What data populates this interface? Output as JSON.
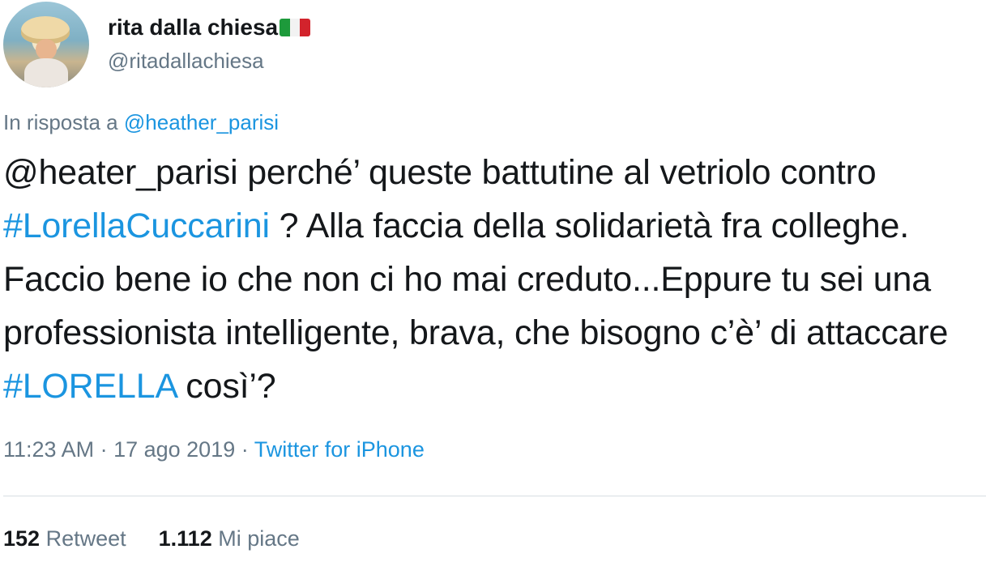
{
  "author": {
    "display_name": "rita dalla chiesa",
    "flag_icon": "italian-flag-icon",
    "handle": "@ritadallachiesa"
  },
  "reply": {
    "prefix": "In risposta a",
    "mention": "@heather_parisi"
  },
  "tweet": {
    "segments": [
      {
        "type": "text",
        "text": "@heater_parisi perché’ queste battutine al vetriolo contro "
      },
      {
        "type": "hashtag",
        "text": "#LorellaCuccarini"
      },
      {
        "type": "text",
        "text": " ? Alla faccia della solidarietà fra colleghe. Faccio bene io che non ci ho mai creduto...Eppure tu sei una professionista intelligente, brava, che bisogno c’è’ di attaccare "
      },
      {
        "type": "hashtag",
        "text": "#LORELLA"
      },
      {
        "type": "text",
        "text": " così’?"
      }
    ]
  },
  "meta": {
    "time": "11:23 AM",
    "sep1": " · ",
    "date": "17 ago 2019",
    "sep2": " · ",
    "source": "Twitter for iPhone"
  },
  "stats": {
    "retweets_count": "152",
    "retweets_label": "Retweet",
    "likes_count": "1.112",
    "likes_label": "Mi piace"
  },
  "colors": {
    "link": "#1b95e0",
    "muted": "#657786",
    "text": "#14171a"
  }
}
